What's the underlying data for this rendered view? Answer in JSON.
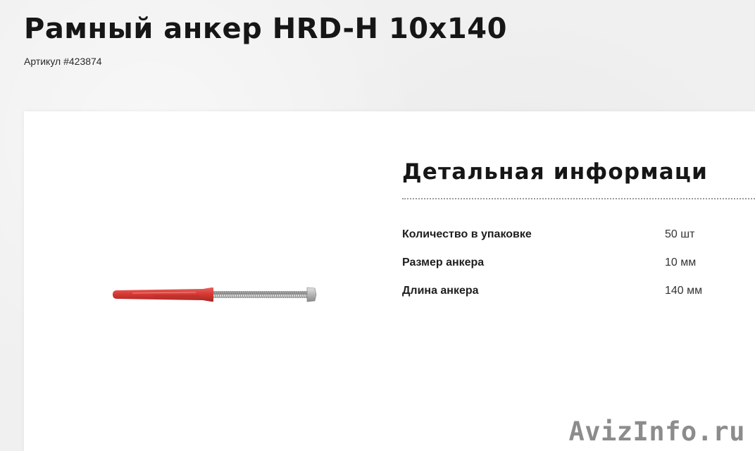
{
  "product": {
    "title": "Рамный анкер HRD-H 10x140",
    "sku_line": "Артикул #423874"
  },
  "details": {
    "heading": "Детальная информаци",
    "specs": [
      {
        "label": "Количество в упаковке",
        "value": "50 шт"
      },
      {
        "label": "Размер анкера",
        "value": "10 мм"
      },
      {
        "label": "Длина анкера",
        "value": "140 мм"
      }
    ]
  },
  "watermark": "AvizInfo.ru",
  "colors": {
    "anchor_sleeve": "#d83a35",
    "anchor_screw": "#b9b9b9",
    "text_dark": "#161616",
    "watermark": "#8c8c8c"
  }
}
